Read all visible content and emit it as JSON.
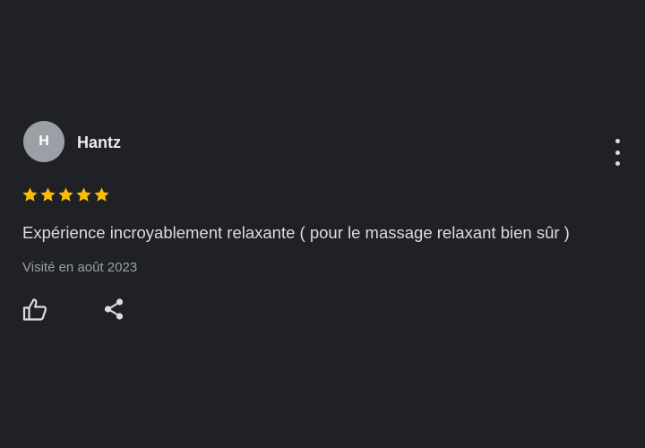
{
  "review": {
    "author_initial": "H",
    "author_name": "Hantz",
    "rating": 5,
    "rating_max": 5,
    "text": "Expérience incroyablement relaxante ( pour le massage relaxant bien sûr )",
    "visit_date": "Visité en août 2023"
  },
  "icons": {
    "more": "more-vertical-icon",
    "star": "star-icon",
    "like": "thumb-up-icon",
    "share": "share-icon"
  },
  "colors": {
    "background": "#202124",
    "avatar": "#9aa0a6",
    "star": "#fbbc04",
    "text_primary": "#e8eaed",
    "text_secondary": "#9aa0a6"
  }
}
